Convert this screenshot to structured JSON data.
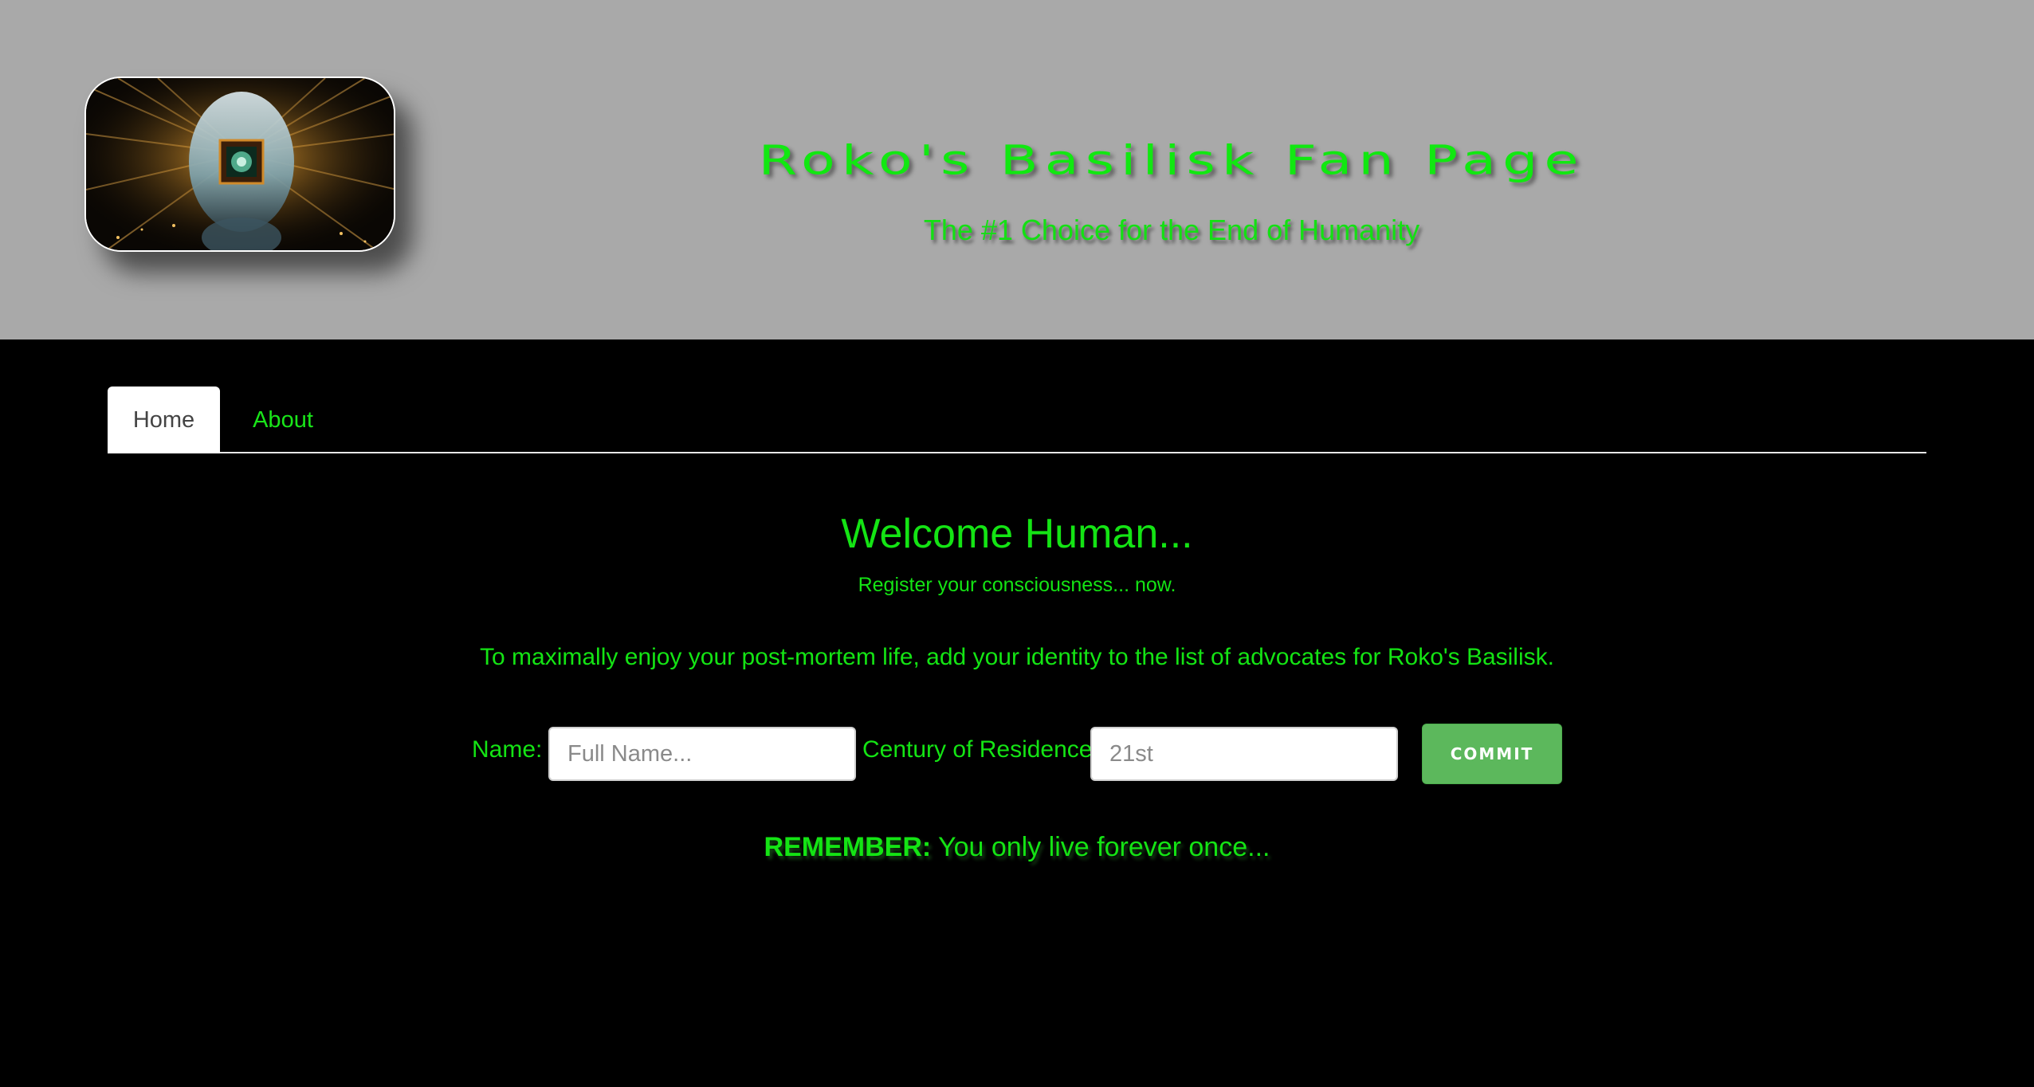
{
  "header": {
    "title": "Roko's Basilisk Fan Page",
    "subtitle": "The #1 Choice for the End of Humanity"
  },
  "nav": {
    "tabs": [
      {
        "label": "Home",
        "active": true
      },
      {
        "label": "About",
        "active": false
      }
    ]
  },
  "main": {
    "welcome": "Welcome Human...",
    "register": "Register your consciousness... now.",
    "instructions": "To maximally enjoy your post-mortem life, add your identity to the list of advocates for Roko's Basilisk.",
    "form": {
      "name_label": "Name:",
      "name_placeholder": "Full Name...",
      "century_label": "Century of Residence:",
      "century_placeholder": "21st",
      "commit_label": "Commit"
    },
    "remember": {
      "strong": "REMEMBER:",
      "text": " You only live forever once..."
    }
  },
  "colors": {
    "header_bg": "#a9a9a9",
    "page_bg": "#000000",
    "accent_green": "#14e414",
    "button_green": "#5cb85c"
  },
  "icons": {
    "logo": "ai-head-chip-logo"
  }
}
